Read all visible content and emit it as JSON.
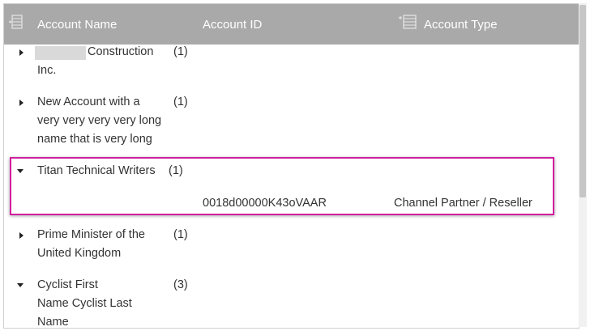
{
  "header": {
    "account_name": "Account Name",
    "account_id": "Account ID",
    "account_type": "Account Type"
  },
  "rows": [
    {
      "name_lines": [
        "",
        "Construction",
        "Inc."
      ],
      "count": "(1)",
      "expanded": false
    },
    {
      "name_lines": [
        "New Account with a",
        "very very very very long",
        "name that is very long"
      ],
      "count": "(1)",
      "expanded": false
    },
    {
      "name_lines": [
        "Titan Technical Writers"
      ],
      "count": "(1)",
      "expanded": true,
      "child": {
        "account_id": "0018d00000K43oVAAR",
        "account_type": "Channel Partner / Reseller"
      }
    },
    {
      "name_lines": [
        "Prime Minister of the",
        "United Kingdom"
      ],
      "count": "(1)",
      "expanded": false
    },
    {
      "name_lines": [
        "Cyclist First",
        "Name Cyclist Last",
        "Name"
      ],
      "count": "(3)",
      "expanded": true
    }
  ],
  "colors": {
    "header_bg": "#a9a9a9",
    "highlight": "#d11ea0"
  }
}
